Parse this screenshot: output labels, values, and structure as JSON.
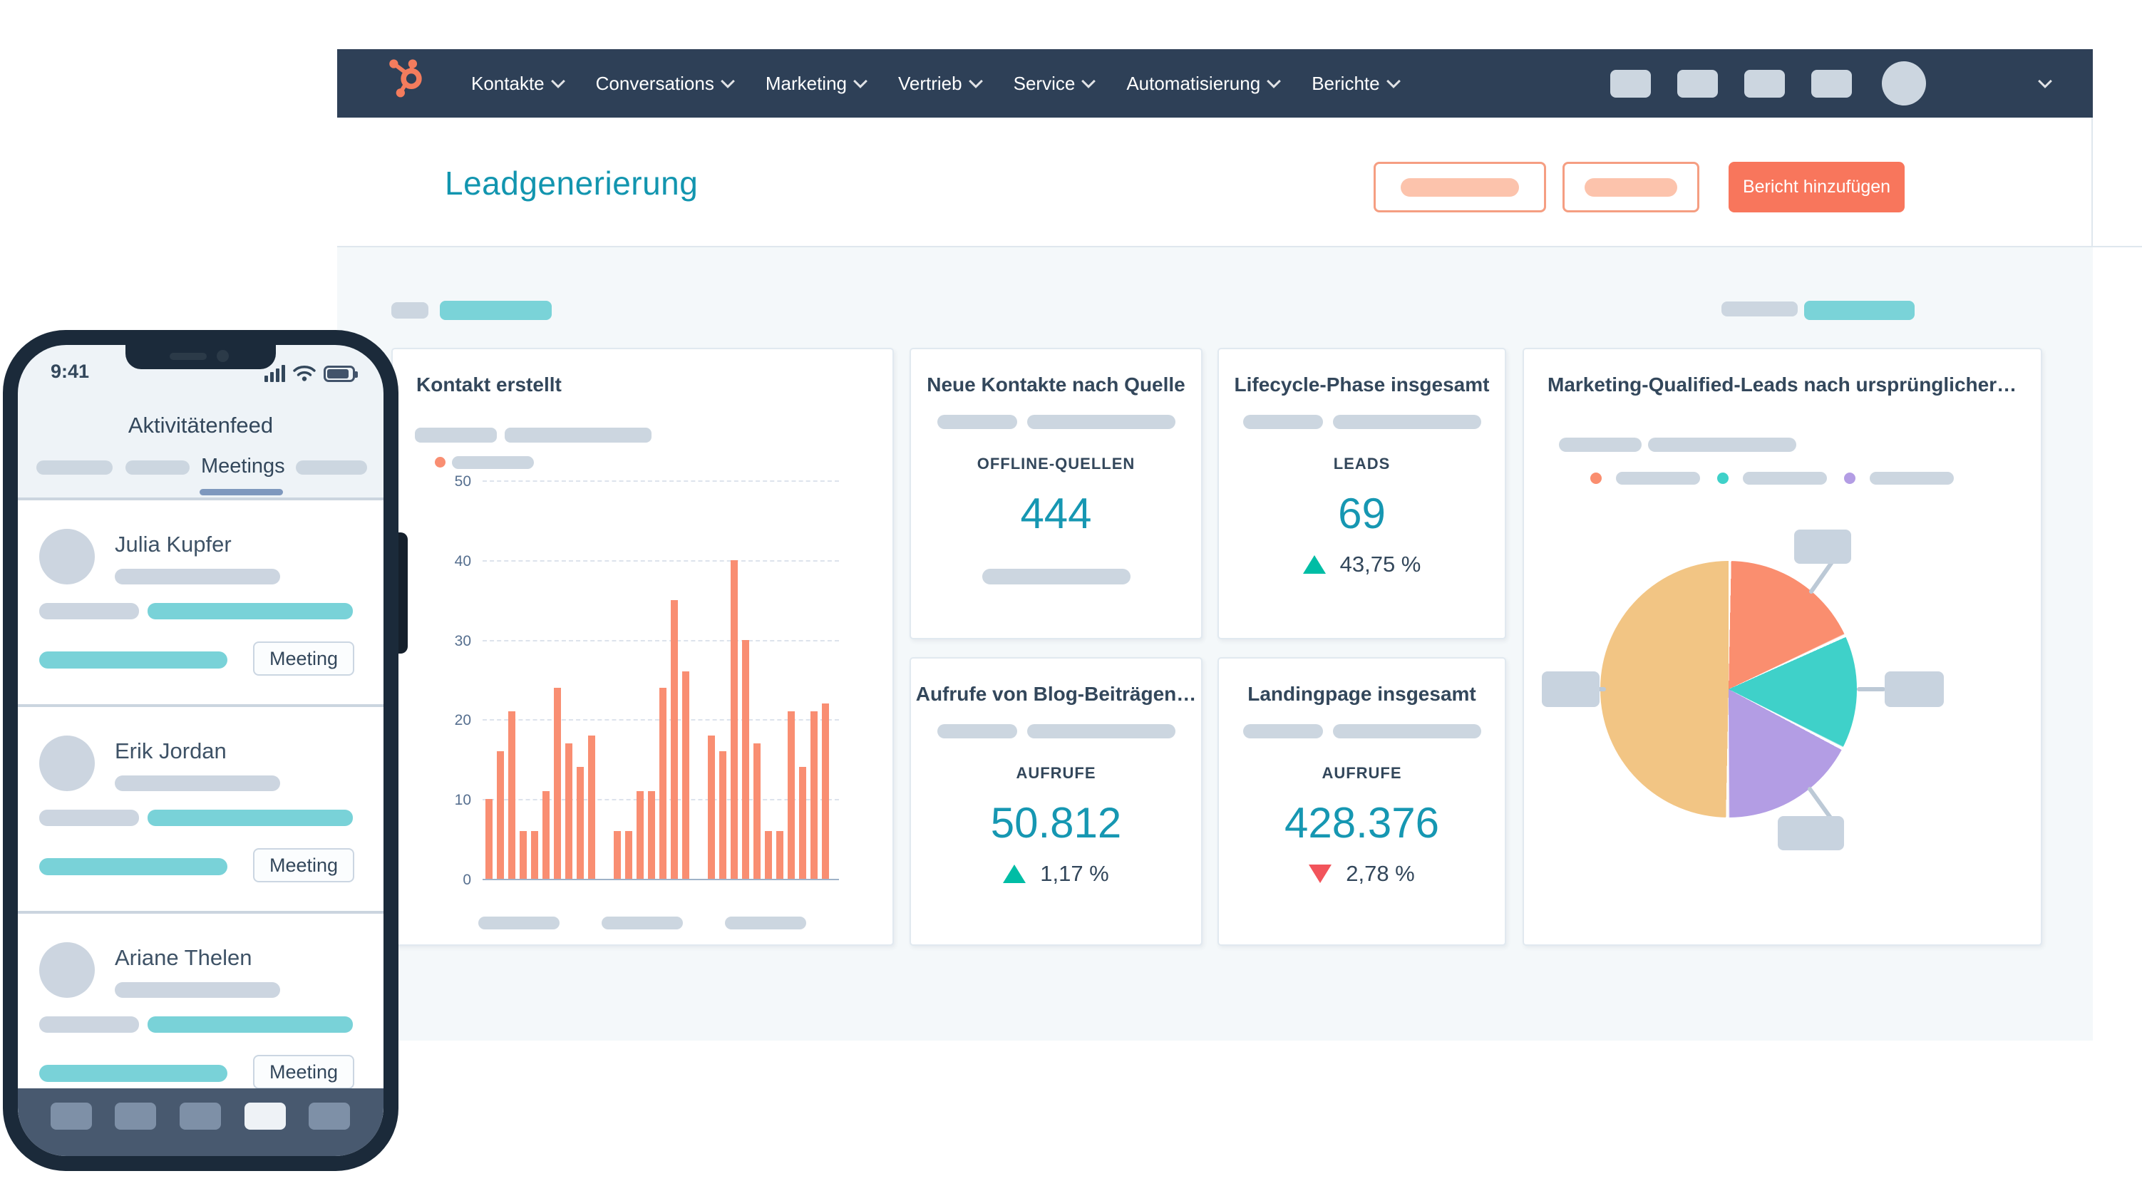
{
  "navbar": {
    "logo": "hubspot-sprocket-logo",
    "menu": [
      "Kontakte",
      "Conversations",
      "Marketing",
      "Vertrieb",
      "Service",
      "Automatisierung",
      "Berichte"
    ]
  },
  "page": {
    "title": "Leadgenerierung",
    "add_report_button": "Bericht hinzufügen"
  },
  "cards": {
    "contact_created": {
      "title": "Kontakt erstellt"
    },
    "new_contacts": {
      "title": "Neue Kontakte nach Quelle",
      "metric_label": "OFFLINE-QUELLEN",
      "value": "444"
    },
    "lifecycle": {
      "title": "Lifecycle-Phase insgesamt",
      "metric_label": "LEADS",
      "value": "69",
      "delta": "43,75 %",
      "delta_direction": "up"
    },
    "blog_views": {
      "title": "Aufrufe von Blog-Beiträgen…",
      "metric_label": "AUFRUFE",
      "value": "50.812",
      "delta": "1,17 %",
      "delta_direction": "up"
    },
    "landing_pages": {
      "title": "Landingpage insgesamt",
      "metric_label": "AUFRUFE",
      "value": "428.376",
      "delta": "2,78 %",
      "delta_direction": "down"
    },
    "mql": {
      "title": "Marketing-Qualified-Leads nach ursprünglicher…"
    }
  },
  "chart_data": [
    {
      "type": "bar",
      "title": "Kontakt erstellt",
      "xlabel": "",
      "ylabel": "",
      "ylim": [
        0,
        55
      ],
      "y_ticks": [
        50,
        40,
        30,
        20,
        10,
        0
      ],
      "grid": "dashed-horizontal",
      "bar_color": "#f98e72",
      "groups": [
        [
          10,
          16,
          21,
          6,
          6,
          11,
          24,
          17,
          14,
          18
        ],
        [
          6,
          6,
          11,
          11,
          24,
          35,
          26
        ],
        [
          18,
          16,
          40,
          30,
          17,
          6,
          6,
          21,
          14,
          21,
          22
        ]
      ]
    },
    {
      "type": "pie",
      "title": "Marketing-Qualified-Leads nach ursprünglicher…",
      "start": "top",
      "direction": "clockwise",
      "slices": [
        {
          "name": "slice-salmon",
          "pct": 18,
          "color": "#fa8e6f"
        },
        {
          "name": "slice-teal",
          "pct": 14.5,
          "color": "#3fd1c9"
        },
        {
          "name": "slice-purple",
          "pct": 17.5,
          "color": "#b39de4"
        },
        {
          "name": "slice-tan",
          "pct": 50,
          "color": "#f2c584"
        }
      ],
      "legend_colors": [
        "#fa8e6f",
        "#3fd1c9",
        "#b39de4"
      ]
    }
  ],
  "phone": {
    "status_time": "9:41",
    "app_title": "Aktivitätenfeed",
    "active_tab": "Meetings",
    "feed": [
      {
        "name": "Julia Kupfer",
        "tag": "Meeting"
      },
      {
        "name": "Erik Jordan",
        "tag": "Meeting"
      },
      {
        "name": "Ariane Thelen",
        "tag": "Meeting"
      }
    ]
  },
  "colors": {
    "nav_navy": "#2e4057",
    "brand_orange": "#f8765c",
    "accent_teal_text": "#1697b2",
    "teal_pill": "#7ad3d8",
    "positive_green": "#00bda5",
    "negative_red": "#f2545b",
    "placeholder_gray": "#ccd6e0",
    "content_bg": "#f4f8fa"
  }
}
